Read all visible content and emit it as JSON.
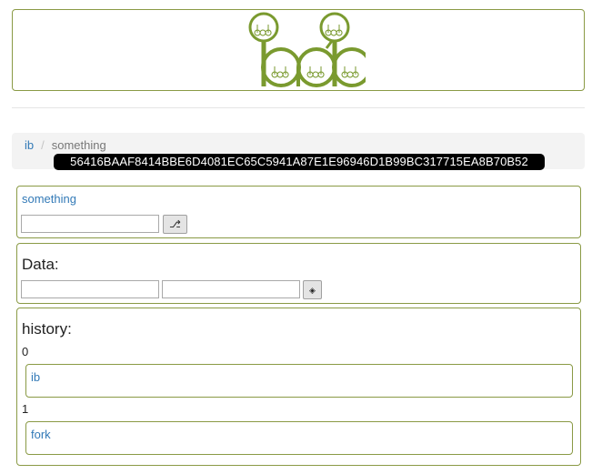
{
  "brand": {
    "logo_icon": "bdb-logo-icon",
    "accent": "#7a9a2f",
    "border": "#8a9a45"
  },
  "breadcrumb": {
    "root": "ib",
    "separator": "/",
    "current": "something"
  },
  "hash": "56416BAAF8414BBE6D4081EC65C5941A87E1E96946D1B99BC317715EA8B70B52",
  "name_panel": {
    "link": "something",
    "input_value": "",
    "button_icon": "branch-icon",
    "button_glyph": "⎇"
  },
  "data_panel": {
    "title": "Data:",
    "key_value": "",
    "value_value": "",
    "button_icon": "add-icon",
    "button_glyph": "◈"
  },
  "history_panel": {
    "title": "history:",
    "items": [
      {
        "index": "0",
        "label": "ib"
      },
      {
        "index": "1",
        "label": "fork"
      }
    ]
  }
}
